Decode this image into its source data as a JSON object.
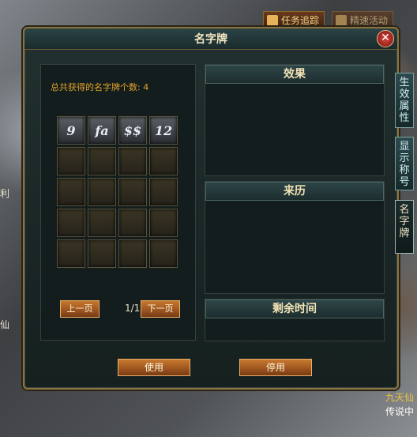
{
  "window": {
    "title": "名字牌",
    "close_symbol": "✕"
  },
  "top_bar": {
    "quest_tracking": "任务追踪",
    "quest_other": "精速活动"
  },
  "left_panel": {
    "summary": "总共获得的名字牌个数: 4",
    "items": [
      "9",
      "fa",
      "$$",
      "12"
    ],
    "pagination": {
      "prev": "上一页",
      "next": "下一页",
      "page": "1/1"
    }
  },
  "right_panel": {
    "sections": [
      {
        "title": "效果"
      },
      {
        "title": "来历"
      },
      {
        "title": "剩余时间"
      }
    ]
  },
  "side_tabs": [
    {
      "label": "生效属性"
    },
    {
      "label": "显示称号"
    },
    {
      "label": "名字牌"
    }
  ],
  "buttons": {
    "use": "使用",
    "disable": "停用"
  },
  "background_text": {
    "left_1": "利",
    "left_2": "仙",
    "right_1": "九天仙",
    "right_2": "传说中"
  },
  "colors": {
    "accent": "#e0a22a",
    "frame_gold": "#8a7440",
    "button_orange": "#c7782f"
  }
}
